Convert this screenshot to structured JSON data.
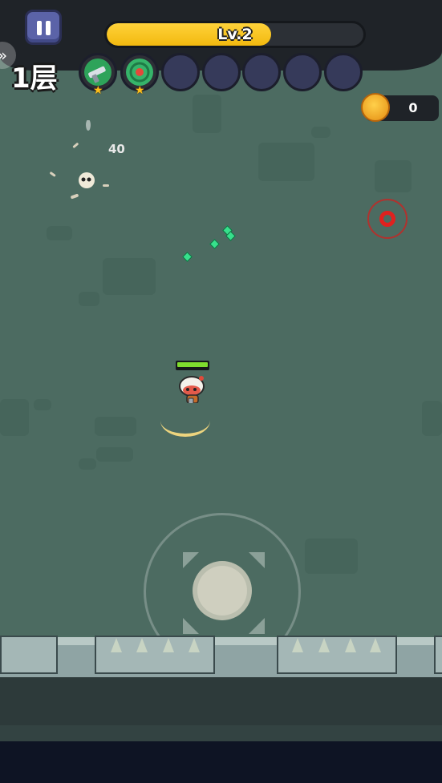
{
  "hud": {
    "level_label": "Lv.2",
    "level_progress": 0.64,
    "floor_label": "1层",
    "coins": "0",
    "back_icon": "chevron-right-double-icon",
    "pause_icon": "pause-icon"
  },
  "skills": [
    {
      "name": "pistol-icon",
      "stars": "★",
      "filled": true
    },
    {
      "name": "target-skill-icon",
      "stars": "★",
      "filled": true
    },
    {
      "name": "empty-slot",
      "stars": "",
      "filled": false
    },
    {
      "name": "empty-slot",
      "stars": "",
      "filled": false
    },
    {
      "name": "empty-slot",
      "stars": "",
      "filled": false
    },
    {
      "name": "empty-slot",
      "stars": "",
      "filled": false
    },
    {
      "name": "empty-slot",
      "stars": "",
      "filled": false
    }
  ],
  "combat": {
    "damage_number": "40",
    "player_hp": 1.0
  },
  "colors": {
    "floor": "#4c6b61",
    "xp_bar": "#f2b90f",
    "hp_bar": "#7fdc2e",
    "enemy_marker": "#e0211f",
    "gem": "#37e08c"
  }
}
